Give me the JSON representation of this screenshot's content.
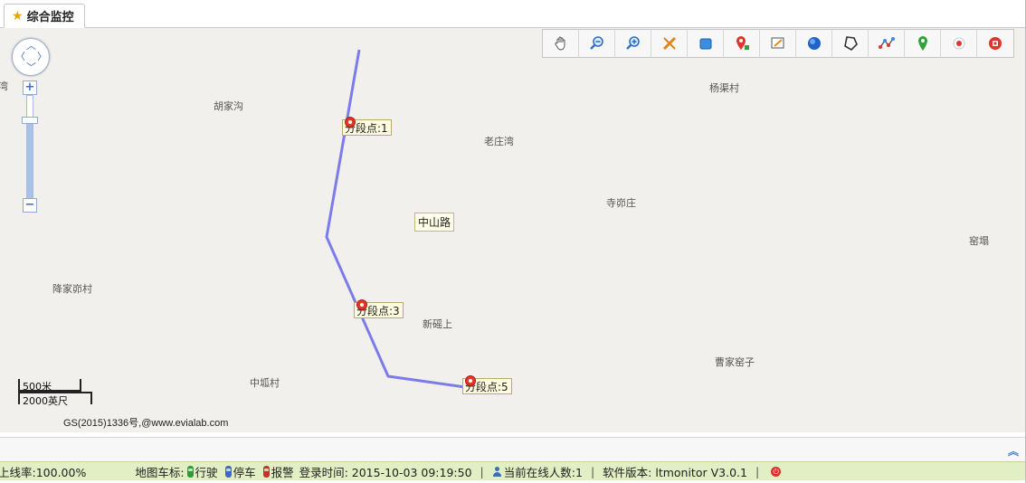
{
  "tab": {
    "label": "综合监控",
    "icon": "star-icon"
  },
  "toolbar": {
    "tools": [
      {
        "name": "pan-hand-icon"
      },
      {
        "name": "zoom-out-icon"
      },
      {
        "name": "zoom-in-icon"
      },
      {
        "name": "measure-distance-icon"
      },
      {
        "name": "measure-area-icon"
      },
      {
        "name": "add-marker-icon"
      },
      {
        "name": "edit-note-icon"
      },
      {
        "name": "circle-region-icon"
      },
      {
        "name": "polygon-region-icon"
      },
      {
        "name": "route-icon"
      },
      {
        "name": "location-pin-icon"
      },
      {
        "name": "record-icon"
      },
      {
        "name": "stop-icon"
      }
    ]
  },
  "map": {
    "places": [
      {
        "id": "p1",
        "text": "湾"
      },
      {
        "id": "p2",
        "text": "胡家沟"
      },
      {
        "id": "p3",
        "text": "杨渠村"
      },
      {
        "id": "p4",
        "text": "老庄湾"
      },
      {
        "id": "p5",
        "text": "寺峁庄"
      },
      {
        "id": "p6",
        "text": "窑塌"
      },
      {
        "id": "p7",
        "text": "降家峁村"
      },
      {
        "id": "p8",
        "text": "新磘上"
      },
      {
        "id": "p9",
        "text": "曹家窑子"
      },
      {
        "id": "p10",
        "text": "中坬村"
      }
    ],
    "road_label": "中山路",
    "segments": [
      {
        "label": "分段点:1"
      },
      {
        "label": "分段点:3"
      },
      {
        "label": "分段点:5"
      }
    ],
    "scale": {
      "metric": "500米",
      "imperial": "2000英尺"
    },
    "copyright": "GS(2015)1336号,@www.evialab.com",
    "route_color": "#7b7bea"
  },
  "status": {
    "online_rate": "上线率:100.00%",
    "map_icons_label": "地图车标:",
    "moving": "行驶",
    "parked": "停车",
    "alarm": "报警",
    "login_time": "登录时间: 2015-10-03 09:19:50",
    "online_users": "当前在线人数:1",
    "version": "软件版本: ltmonitor V3.0.1",
    "sep": "|",
    "colors": {
      "moving": "#2e9a3a",
      "parked": "#3f66c9",
      "alarm": "#c8312b",
      "bar": "#e2eec4"
    }
  }
}
